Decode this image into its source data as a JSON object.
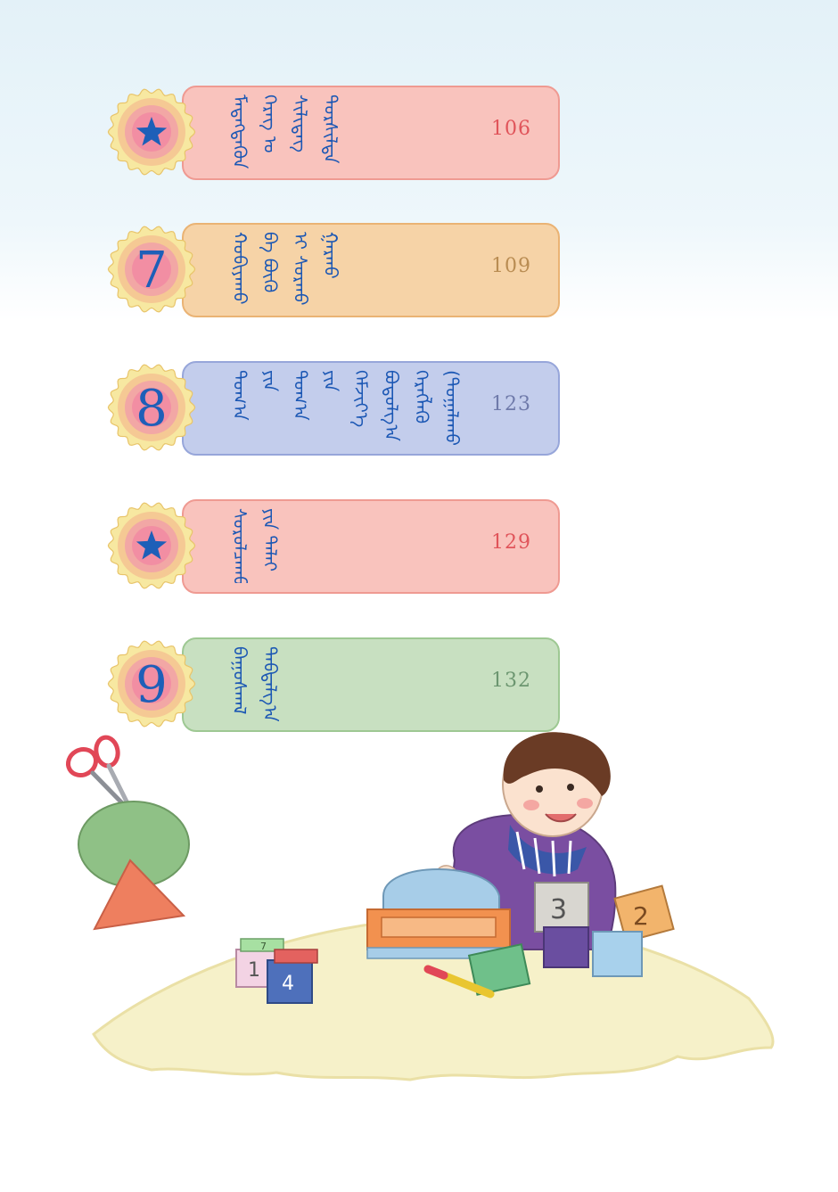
{
  "entries": [
    {
      "badge_type": "star",
      "badge_label": "",
      "title": "ᠮᠡᠳᠡᠭᠳᠡᠬᠦᠨ ᠬᠡᠷᠡᠭ ᠤ ᠰᠢᠯᠢᠳᠡᠭ ᠲᠤᠷᠰᠢᠯᠲᠠ",
      "page": "106",
      "bar_fill": "#f9c3bd",
      "bar_border": "#ef9a92",
      "page_color": "#e0545a"
    },
    {
      "badge_type": "number",
      "badge_label": "7",
      "title": "ᠬᠤᠪᠢᠶᠠᠬᠤ ᠪᠠ ᠪᠦᠬᠦ ᠢ ᠰᠤᠷᠬᠤ ᠭᠠᠷᠬᠤ",
      "page": "109",
      "bar_fill": "#f6d3a7",
      "bar_border": "#eab374",
      "page_color": "#b98c52"
    },
    {
      "badge_type": "number",
      "badge_label": "8",
      "title": "ᠲᠣᠭ᠎ᠠ ᠶᠢᠨ ᠲᠣᠭ᠎ᠠ ᠶᠢᠨ ᠬᠡᠮᠵᠢᠶ᠎ᠡ ᠪᠤᠳᠤᠯᠭ᠎ᠠ ᠬᠡᠷᠡᠭᠯᠡᠬᠦ (ᠲᠣᠭᠠᠯᠠᠬᠤ)",
      "page": "123",
      "bar_fill": "#c3cdec",
      "bar_border": "#97a6da",
      "page_color": "#6f7aaa"
    },
    {
      "badge_type": "star",
      "badge_label": "",
      "title": "ᠰᠤᠷᠤᠯᠴᠠᠬᠤ ᠶᠢᠨ ᠳᠠᠯᠠᠢ",
      "page": "129",
      "bar_fill": "#f9c3bd",
      "bar_border": "#ef9a92",
      "page_color": "#e0545a"
    },
    {
      "badge_type": "number",
      "badge_label": "9",
      "title": "ᠪᠠᠭᠤᠰᠬᠠᠯ ᠳᠠᠪᠲᠠᠯᠭ᠎ᠠ",
      "page": "132",
      "bar_fill": "#c8e0c1",
      "bar_border": "#9ec893",
      "page_color": "#6c9670"
    }
  ],
  "badge_colors": {
    "ring_outer": "#f7e8a1",
    "ring_mid": "#f5c994",
    "ring_inner": "#f2a7a5",
    "core": "#f28ea3",
    "glyph": "#1e5fb8",
    "scallop_border": "#e8c46a"
  },
  "illustration": {
    "block_labels": [
      "1",
      "3",
      "2",
      "1",
      "4",
      "7"
    ]
  }
}
